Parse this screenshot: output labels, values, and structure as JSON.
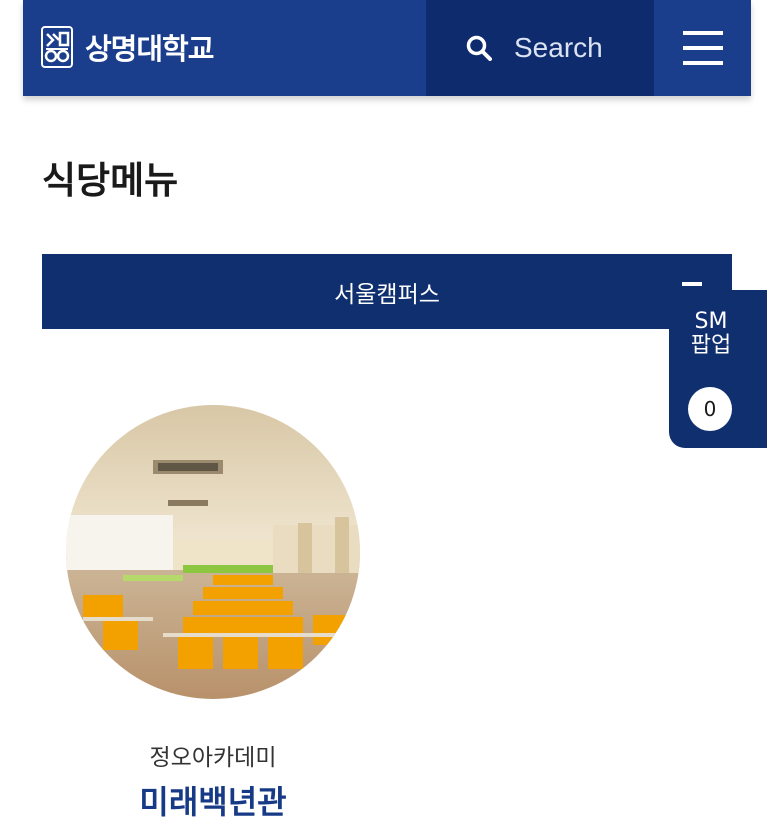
{
  "header": {
    "logo_text": "상명대학교",
    "search_label": "Search",
    "icons": {
      "logo": "university-seal-icon",
      "search": "search-icon",
      "menu": "hamburger-menu-icon"
    }
  },
  "page": {
    "title": "식당메뉴"
  },
  "campus_select": {
    "selected": "서울캠퍼스",
    "icon": "chevron-down-icon"
  },
  "sm_popup": {
    "label_line1": "SM",
    "label_line2": "팝업",
    "count": "0"
  },
  "restaurant": {
    "subtitle": "정오아카데미",
    "name": "미래백년관",
    "image": "cafeteria-photo"
  },
  "colors": {
    "header": "#1a3d8c",
    "search_bg": "#0e2b6e",
    "accent": "#0f2f6e",
    "name": "#173a86"
  }
}
